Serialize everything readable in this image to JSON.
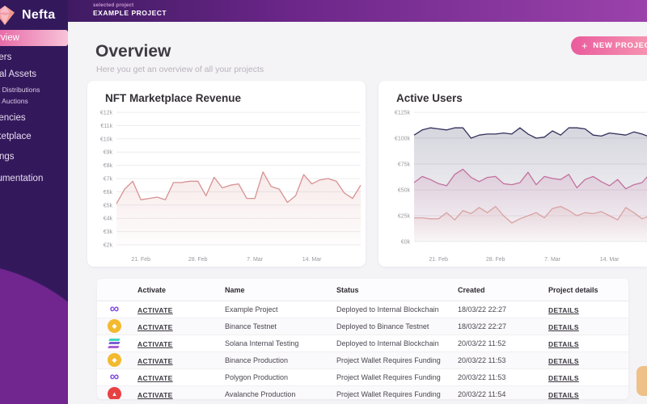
{
  "sidebar": {
    "logo": "Nefta",
    "items": [
      {
        "label": "Overview",
        "active": true,
        "sub": false
      },
      {
        "label": "Players",
        "active": false,
        "sub": false
      },
      {
        "label": "Digital Assets",
        "active": false,
        "sub": false
      },
      {
        "label": "Asset Distributions",
        "active": false,
        "sub": true
      },
      {
        "label": "Asset Auctions",
        "active": false,
        "sub": true
      },
      {
        "label": "Currencies",
        "active": false,
        "sub": false
      },
      {
        "label": "Marketplace",
        "active": false,
        "sub": false
      },
      {
        "label": "Settings",
        "active": false,
        "sub": false
      },
      {
        "label": "Documentation",
        "active": false,
        "sub": false
      }
    ]
  },
  "topbar": {
    "selected_project_label": "selected project",
    "project_name": "EXAMPLE PROJECT"
  },
  "header": {
    "title": "Overview",
    "subtitle": "Here you get an overview of all your projects",
    "new_project_button": "NEW PROJECT"
  },
  "icons": {
    "plus-icon": "+",
    "polygon-icon": "∞",
    "binance-icon": "◆",
    "avalanche-icon": "▲",
    "solana-icon": "bars"
  },
  "colors": {
    "accent_pink": "#ec5f9d",
    "sidebar_purple": "#33195c",
    "sidebar_blob_purple": "#71258e",
    "topbar_gradient_start": "#3f1b63",
    "topbar_gradient_end": "#9b42ab",
    "active_nav_start": "#e3549b",
    "active_nav_end": "#f8c3d8",
    "revenue_line": "#d89191",
    "users_line_total": "#32305a",
    "users_line_mid": "#c2709e",
    "users_line_low": "#d9a2a2",
    "polygon": "#8247e5",
    "binance": "#f3ba2f",
    "avalanche": "#e84142",
    "solana_teal": "#3fd6c0",
    "solana_purple": "#a85fd0",
    "chat_bubble": "#eec189"
  },
  "chart_data": [
    {
      "type": "line",
      "title": "NFT Marketplace Revenue",
      "xlabel": "",
      "ylabel": "",
      "unit": "k EUR",
      "grid": true,
      "legend": false,
      "ylim": [
        2,
        12
      ],
      "ytick_values": [
        12,
        11,
        10,
        9,
        8,
        7,
        6,
        5,
        4,
        3,
        2
      ],
      "ytick_labels": [
        "€12k",
        "€11k",
        "€10k",
        "€9k",
        "€8k",
        "€7k",
        "€6k",
        "€5k",
        "€4k",
        "€3k",
        "€2k"
      ],
      "x_tick_labels": [
        "21. Feb",
        "28. Feb",
        "7. Mar",
        "14. Mar"
      ],
      "x_tick_indices": [
        3,
        10,
        17,
        24
      ],
      "series": [
        {
          "color": "#d89191",
          "values": [
            5.1,
            6.2,
            6.8,
            5.4,
            5.5,
            5.6,
            5.4,
            6.7,
            6.7,
            6.8,
            6.8,
            5.7,
            7.1,
            6.3,
            6.5,
            6.6,
            5.5,
            5.5,
            7.5,
            6.4,
            6.2,
            5.2,
            5.7,
            7.3,
            6.6,
            6.9,
            7.0,
            6.8,
            5.9,
            5.5,
            6.5
          ]
        }
      ]
    },
    {
      "type": "line",
      "title": "Active Users",
      "xlabel": "",
      "ylabel": "",
      "unit": "k",
      "grid": true,
      "legend": false,
      "ylim": [
        0,
        125
      ],
      "ytick_values": [
        125,
        100,
        75,
        50,
        25,
        0
      ],
      "ytick_labels": [
        "€125k",
        "€100k",
        "€75k",
        "€50k",
        "€25k",
        "€0k"
      ],
      "x_tick_labels": [
        "21. Feb",
        "28. Feb",
        "7. Mar",
        "14. Mar"
      ],
      "x_tick_indices": [
        3,
        10,
        17,
        24
      ],
      "series": [
        {
          "color": "#32305a",
          "values": [
            103,
            108,
            110,
            109,
            108,
            110,
            110,
            100,
            103,
            104,
            104,
            105,
            104,
            110,
            104,
            100,
            101,
            107,
            103,
            110,
            110,
            109,
            103,
            102,
            105,
            104,
            103,
            106,
            104,
            101,
            103
          ]
        },
        {
          "color": "#c2709e",
          "values": [
            57,
            63,
            60,
            56,
            54,
            65,
            70,
            62,
            58,
            62,
            63,
            56,
            55,
            57,
            67,
            55,
            63,
            61,
            60,
            65,
            52,
            60,
            63,
            58,
            54,
            60,
            51,
            55,
            57,
            66,
            62
          ]
        },
        {
          "color": "#d9a2a2",
          "values": [
            23,
            23,
            22,
            22,
            28,
            21,
            30,
            27,
            33,
            28,
            34,
            25,
            18,
            22,
            25,
            28,
            23,
            32,
            34,
            30,
            25,
            28,
            27,
            29,
            25,
            21,
            33,
            28,
            22,
            25,
            28
          ]
        }
      ]
    }
  ],
  "table": {
    "columns": [
      "Activate",
      "Name",
      "Status",
      "Created",
      "Project details"
    ],
    "rows": [
      {
        "chain": "polygon",
        "chain_icon": "polygon-icon",
        "activate_label": "ACTIVATE",
        "name": "Example Project",
        "status": "Deployed to Internal Blockchain",
        "created": "18/03/22 22:27",
        "details_label": "DETAILS"
      },
      {
        "chain": "binance",
        "chain_icon": "binance-icon",
        "activate_label": "ACTIVATE",
        "name": "Binance Testnet",
        "status": "Deployed to Binance Testnet",
        "created": "18/03/22 22:27",
        "details_label": "DETAILS"
      },
      {
        "chain": "solana",
        "chain_icon": "solana-icon",
        "activate_label": "ACTIVATE",
        "name": "Solana Internal Testing",
        "status": "Deployed to Internal Blockchain",
        "created": "20/03/22 11:52",
        "details_label": "DETAILS"
      },
      {
        "chain": "binance",
        "chain_icon": "binance-icon",
        "activate_label": "ACTIVATE",
        "name": "Binance Production",
        "status": "Project Wallet Requires Funding",
        "created": "20/03/22 11:53",
        "details_label": "DETAILS"
      },
      {
        "chain": "polygon",
        "chain_icon": "polygon-icon",
        "activate_label": "ACTIVATE",
        "name": "Polygon Production",
        "status": "Project Wallet Requires Funding",
        "created": "20/03/22 11:53",
        "details_label": "DETAILS"
      },
      {
        "chain": "avalanche",
        "chain_icon": "avalanche-icon",
        "activate_label": "ACTIVATE",
        "name": "Avalanche Production",
        "status": "Project Wallet Requires Funding",
        "created": "20/03/22 11:54",
        "details_label": "DETAILS"
      }
    ]
  }
}
